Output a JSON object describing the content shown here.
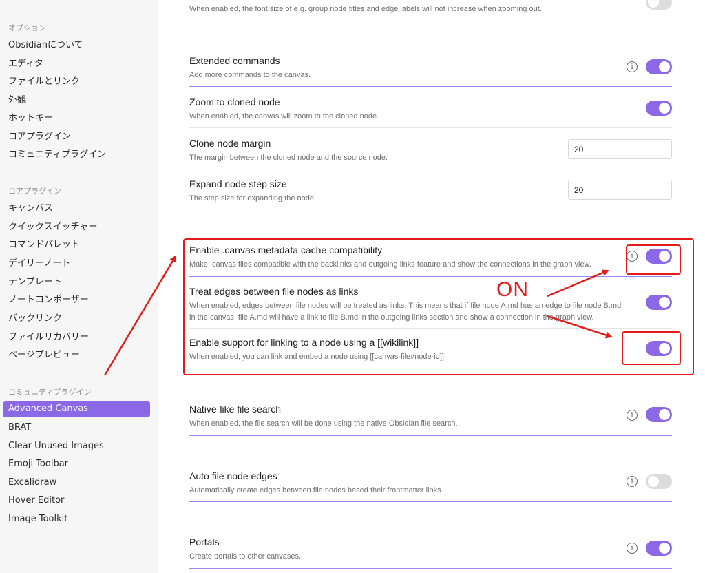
{
  "sidebar": {
    "options_heading": "オプション",
    "options": [
      "Obsidianについて",
      "エディタ",
      "ファイルとリンク",
      "外観",
      "ホットキー",
      "コアプラグイン",
      "コミュニティプラグイン"
    ],
    "core_heading": "コアプラグイン",
    "core": [
      "キャンバス",
      "クイックスイッチャー",
      "コマンドパレット",
      "デイリーノート",
      "テンプレート",
      "ノートコンポーザー",
      "バックリンク",
      "ファイルリカバリー",
      "ページプレビュー"
    ],
    "community_heading": "コミュニティプラグイン",
    "community": [
      "Advanced Canvas",
      "BRAT",
      "Clear Unused Images",
      "Emoji Toolbar",
      "Excalidraw",
      "Hover Editor",
      "Image Toolkit"
    ],
    "active": "Advanced Canvas"
  },
  "settings": {
    "top_desc": "When enabled, the font size of e.g. group node titles and edge labels will not increase when zooming out.",
    "extended": {
      "title": "Extended commands",
      "desc": "Add more commands to the canvas.",
      "on": true
    },
    "zoom": {
      "title": "Zoom to cloned node",
      "desc": "When enabled, the canvas will zoom to the cloned node.",
      "on": true
    },
    "clone_margin": {
      "title": "Clone node margin",
      "desc": "The margin between the cloned node and the source node.",
      "value": "20"
    },
    "expand_step": {
      "title": "Expand node step size",
      "desc": "The step size for expanding the node.",
      "value": "20"
    },
    "metadata": {
      "title": "Enable .canvas metadata cache compatibility",
      "desc": "Make .canvas files compatible with the backlinks and outgoing links feature and show the connections in the graph view.",
      "on": true
    },
    "edges_links": {
      "title": "Treat edges between file nodes as links",
      "desc": "When enabled, edges between file nodes will be treated as links. This means that if file node A.md has an edge to file node B.md in the canvas, file A.md will have a link to file B.md in the outgoing links section and show a connection in the graph view.",
      "on": true
    },
    "wikilink": {
      "title": "Enable support for linking to a node using a [[wikilink]]",
      "desc": "When enabled, you can link and embed a node using [[canvas-file#node-id]].",
      "on": true
    },
    "native_search": {
      "title": "Native-like file search",
      "desc": "When enabled, the file search will be done using the native Obsidian file search.",
      "on": true
    },
    "auto_edges": {
      "title": "Auto file node edges",
      "desc": "Automatically create edges between file nodes based their frontmatter links.",
      "on": false
    },
    "portals": {
      "title": "Portals",
      "desc": "Create portals to other canvases.",
      "on": true
    }
  },
  "annotation": {
    "label": "ON",
    "color": "#e31b1b"
  },
  "colors": {
    "accent": "#8a68e6",
    "annotation": "#e31b1b"
  },
  "icons": {
    "info": "i"
  }
}
